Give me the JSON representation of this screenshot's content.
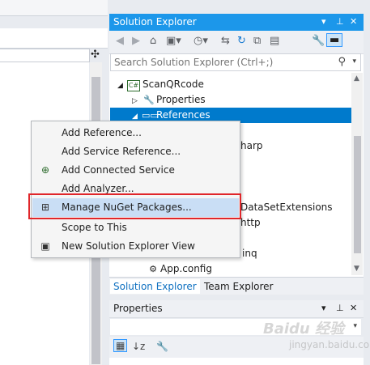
{
  "solution_explorer": {
    "title": "Solution Explorer",
    "title_icons": [
      "dropdown-arrow-icon",
      "pin-icon",
      "close-icon"
    ],
    "toolbar_icons": [
      "back-icon",
      "forward-icon",
      "home-icon",
      "switch-views-icon",
      "pending-changes-icon",
      "sync-icon",
      "refresh-icon",
      "collapse-all-icon",
      "show-all-files-icon",
      "properties-icon",
      "preview-icon"
    ],
    "search_placeholder": "Search Solution Explorer (Ctrl+;)",
    "tree": {
      "project": "ScanQRcode",
      "project_badge": "C#",
      "properties": "Properties",
      "references": "References",
      "partial_visible": {
        "harp": "harp",
        "dataset": "DataSetExtensions",
        "http": "http",
        "linq": "inq"
      },
      "app_config": "App.config"
    },
    "tabs": [
      "Solution Explorer",
      "Team Explorer"
    ]
  },
  "properties_panel": {
    "title": "Properties"
  },
  "context_menu": {
    "items": [
      {
        "label": "Add Reference...",
        "icon": ""
      },
      {
        "label": "Add Service Reference...",
        "icon": ""
      },
      {
        "label": "Add Connected Service",
        "icon": "connected-service-icon"
      },
      {
        "label": "Add Analyzer...",
        "icon": ""
      },
      {
        "label": "Manage NuGet Packages...",
        "icon": "nuget-icon"
      },
      {
        "label": "Scope to This",
        "icon": ""
      },
      {
        "label": "New Solution Explorer View",
        "icon": "new-view-icon"
      }
    ],
    "highlighted_index": 4
  },
  "watermark": {
    "text": "Baidu 经验",
    "sub": "jingyan.baidu.com"
  },
  "colors": {
    "title_active": "#1c97ea",
    "selection": "#007acc",
    "highlight_border": "#e0262a",
    "menu_highlight": "#c9def5"
  }
}
